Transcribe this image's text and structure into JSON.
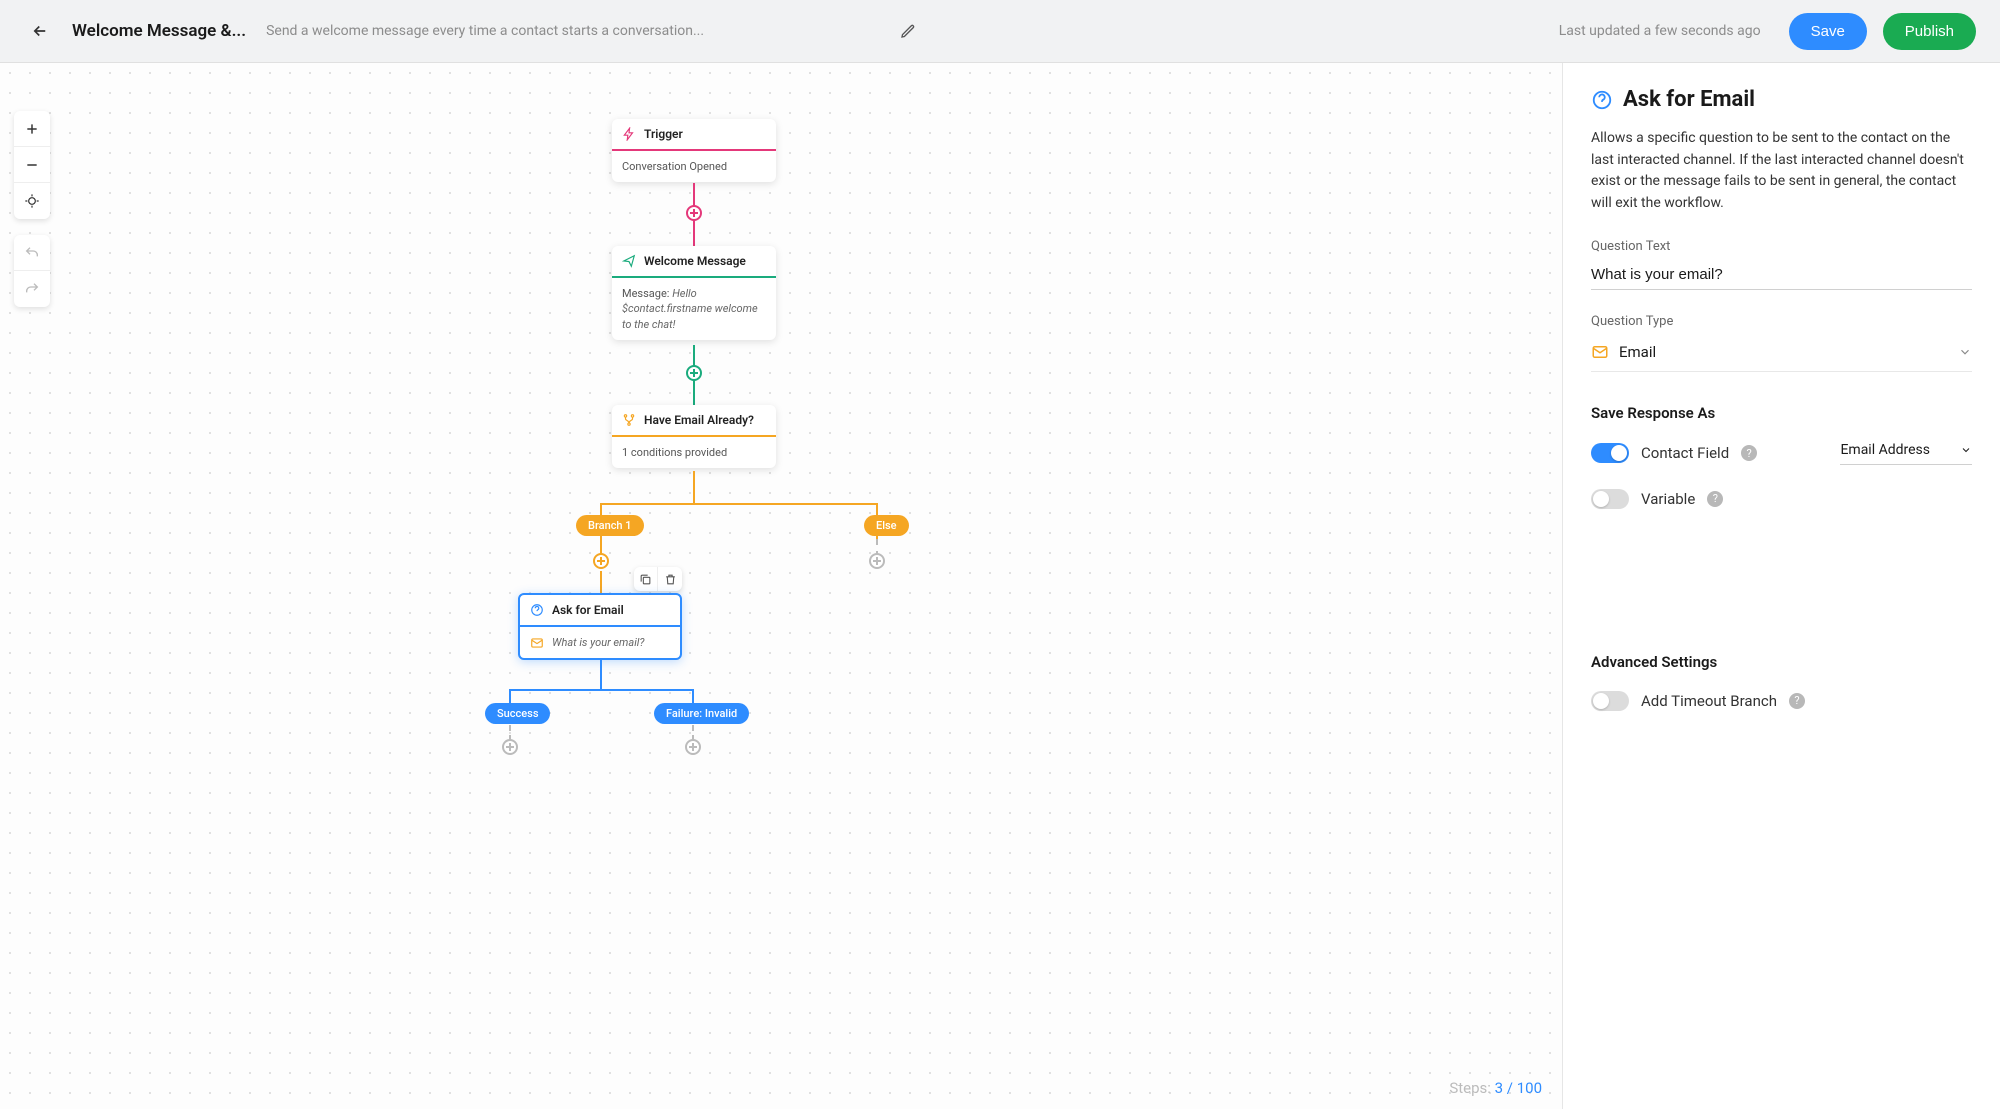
{
  "header": {
    "title": "Welcome Message &...",
    "subtitle": "Send a welcome message every time a contact starts a conversation...",
    "timestamp": "Last updated a few seconds ago",
    "save_label": "Save",
    "publish_label": "Publish"
  },
  "canvas": {
    "trigger": {
      "title": "Trigger",
      "body": "Conversation Opened"
    },
    "welcome": {
      "title": "Welcome Message",
      "body_label": "Message: ",
      "body_msg": "Hello $contact.firstname welcome to the chat!"
    },
    "branch": {
      "title": "Have Email Already?",
      "body": "1 conditions provided"
    },
    "ask": {
      "title": "Ask for Email",
      "body": "What is your email?"
    },
    "pill_branch1": "Branch 1",
    "pill_else": "Else",
    "pill_success": "Success",
    "pill_failure": "Failure: Invalid",
    "steps_label": "Steps: ",
    "steps_current": "3",
    "steps_sep": " / ",
    "steps_max": "100"
  },
  "panel": {
    "title": "Ask for Email",
    "description": "Allows a specific question to be sent to the contact on the last interacted channel. If the last interacted channel doesn't exist or the message fails to be sent in general, the contact will exit the workflow.",
    "question_text_label": "Question Text",
    "question_text_value": "What is your email?",
    "question_type_label": "Question Type",
    "question_type_value": "Email",
    "save_response_heading": "Save Response As",
    "contact_field_label": "Contact Field",
    "contact_field_value": "Email Address",
    "variable_label": "Variable",
    "advanced_heading": "Advanced Settings",
    "timeout_label": "Add Timeout Branch"
  }
}
